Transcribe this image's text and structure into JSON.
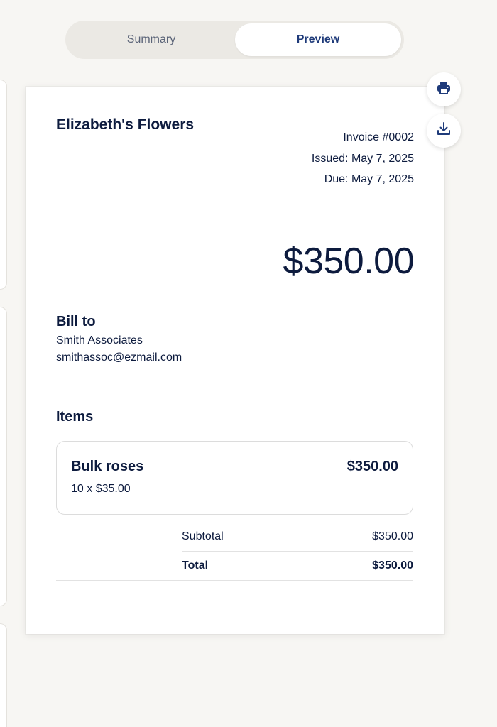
{
  "tabs": {
    "summary_label": "Summary",
    "preview_label": "Preview",
    "active": "Preview"
  },
  "actions": {
    "print_icon": "printer-icon",
    "download_icon": "download-icon"
  },
  "invoice": {
    "business_name": "Elizabeth's Flowers",
    "number": "Invoice #0002",
    "issued": "Issued: May 7, 2025",
    "due": "Due: May 7, 2025",
    "amount": "$350.00",
    "bill_to": {
      "heading": "Bill to",
      "name": "Smith Associates",
      "email": "smithassoc@ezmail.com"
    },
    "items_heading": "Items",
    "items": [
      {
        "name": "Bulk roses",
        "price": "$350.00",
        "detail": "10 x $35.00"
      }
    ],
    "subtotal_label": "Subtotal",
    "subtotal_value": "$350.00",
    "total_label": "Total",
    "total_value": "$350.00"
  },
  "colors": {
    "ink": "#0d1b3e",
    "accent": "#1f3b7a",
    "background": "#f7f6f3"
  }
}
